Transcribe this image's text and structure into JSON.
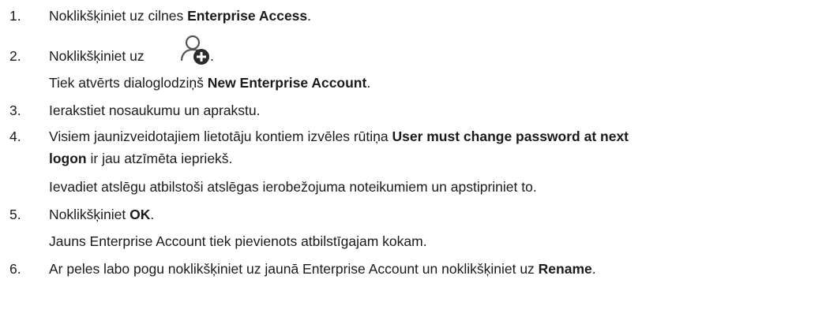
{
  "steps": [
    {
      "num": "1.",
      "a": "Noklikšķiniet uz cilnes ",
      "b1": "Enterprise Access",
      "c": "."
    },
    {
      "num": "2.",
      "a": "Noklikšķiniet uz",
      "icon": "add-user-icon",
      "c": ".",
      "sub_a": "Tiek atvērts dialoglodziņš ",
      "sub_b": "New Enterprise Account",
      "sub_c": "."
    },
    {
      "num": "3.",
      "a": "Ierakstiet nosaukumu un aprakstu."
    },
    {
      "num": "4.",
      "a": "Visiem jaunizveidotajiem lietotāju kontiem izvēles rūtiņa ",
      "b1": "User must change password at next",
      "b2": "logon",
      "c": " ir jau atzīmēta iepriekš.",
      "sub_a": "Ievadiet atslēgu atbilstoši atslēgas ierobežojuma noteikumiem un apstipriniet to."
    },
    {
      "num": "5.",
      "a": "Noklikšķiniet ",
      "b1": "OK",
      "c": ".",
      "sub_a": "Jauns Enterprise Account tiek pievienots atbilstīgajam kokam."
    },
    {
      "num": "6.",
      "a": "Ar peles labo pogu noklikšķiniet uz jaunā Enterprise Account un noklikšķiniet uz ",
      "b1": "Rename",
      "c": "."
    }
  ]
}
